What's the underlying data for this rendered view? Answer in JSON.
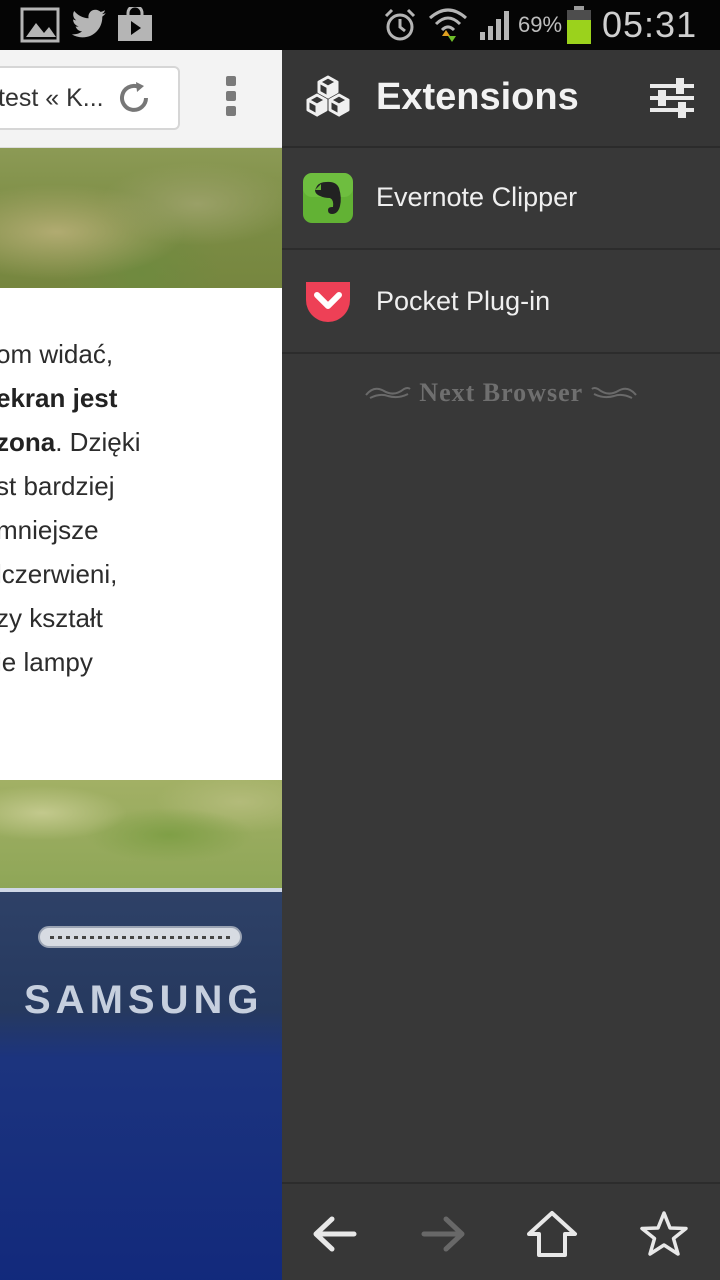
{
  "status_bar": {
    "icons": [
      "gallery-icon",
      "twitter-icon",
      "store-icon",
      "alarm-icon",
      "wifi-icon",
      "signal-icon",
      "battery-icon"
    ],
    "battery_percent": "69%",
    "time": "05:31"
  },
  "browser": {
    "url_text": "test « K...",
    "article_lines": [
      {
        "text": "om widać,",
        "bold": false
      },
      {
        "text": "ekran jest",
        "bold": true
      },
      {
        "bold_part": "zona",
        "rest": ". Dzięki"
      },
      {
        "text": "st bardziej",
        "bold": false
      },
      {
        "text": " mniejsze",
        "bold": false
      },
      {
        "text": "lczerwieni,",
        "bold": false
      },
      {
        "text": "zy kształt",
        "bold": false
      },
      {
        "text": "ie lampy",
        "bold": false
      }
    ],
    "photo_brand_text": "SAMSUNG"
  },
  "extensions_panel": {
    "title": "Extensions",
    "items": [
      {
        "label": "Evernote Clipper",
        "icon": "evernote-icon",
        "color": "#62b234"
      },
      {
        "label": "Pocket Plug-in",
        "icon": "pocket-icon",
        "color": "#ee4056"
      }
    ],
    "brand": "Next Browser"
  },
  "bottom_bar": {
    "buttons": [
      {
        "name": "back",
        "icon": "arrow-left-icon",
        "enabled": true
      },
      {
        "name": "forward",
        "icon": "arrow-right-icon",
        "enabled": false
      },
      {
        "name": "home",
        "icon": "home-icon",
        "enabled": true
      },
      {
        "name": "bookmark",
        "icon": "star-icon",
        "enabled": true
      }
    ]
  }
}
